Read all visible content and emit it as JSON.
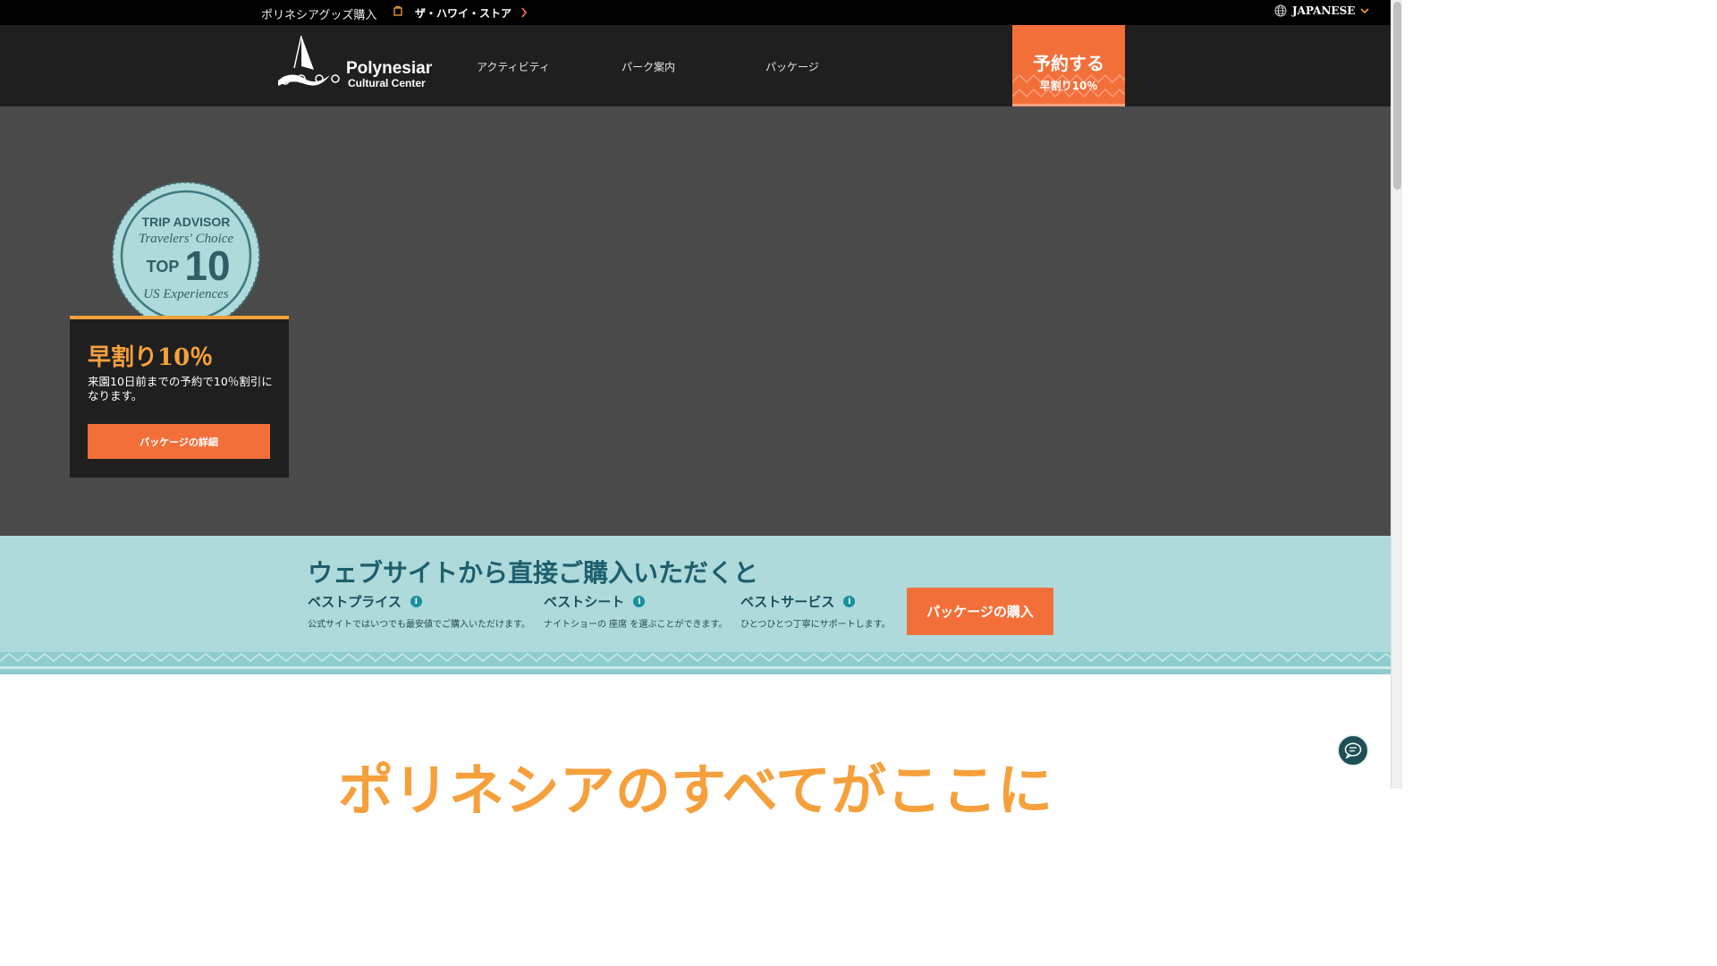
{
  "topbar": {
    "shop_text": "ポリネシアグッズ購入",
    "store_link": "ザ・ハワイ・ストア",
    "language": "JAPANESE"
  },
  "nav": {
    "logo_line1": "Polynesian",
    "logo_line2": "Cultural Center",
    "items": [
      "アクティビティ",
      "パーク案内",
      "パッケージ"
    ],
    "book_label": "予約する",
    "book_sub": "早割り10％"
  },
  "hero": {
    "badge": {
      "line1": "TRIP ADVISOR",
      "line2": "Travelers' Choice",
      "line3a": "TOP",
      "line3b": "10",
      "line4": "US Experiences"
    },
    "promo_title": "早割り10％",
    "promo_desc": "来園10日前までの予約で10％割引になります。",
    "promo_button": "パッケージの詳細"
  },
  "benefits": {
    "heading": "ウェブサイトから直接ご購入いただくと",
    "items": [
      {
        "title": "ベストプライス",
        "desc": "公式サイトではいつでも最安値でご購入いただけます。"
      },
      {
        "title": "ベストシート",
        "desc": "ナイトショーの 座席 を選ぶことができます。"
      },
      {
        "title": "ベストサービス",
        "desc": "ひとつひとつ丁寧にサポートします。"
      }
    ],
    "buy_button": "パッケージの購入"
  },
  "section_heading": "ポリネシアのすべてがここに",
  "colors": {
    "accent_orange": "#f36f3a",
    "gold": "#f6a03c",
    "teal_band": "#aedadb",
    "dark": "#1f1f1f"
  }
}
